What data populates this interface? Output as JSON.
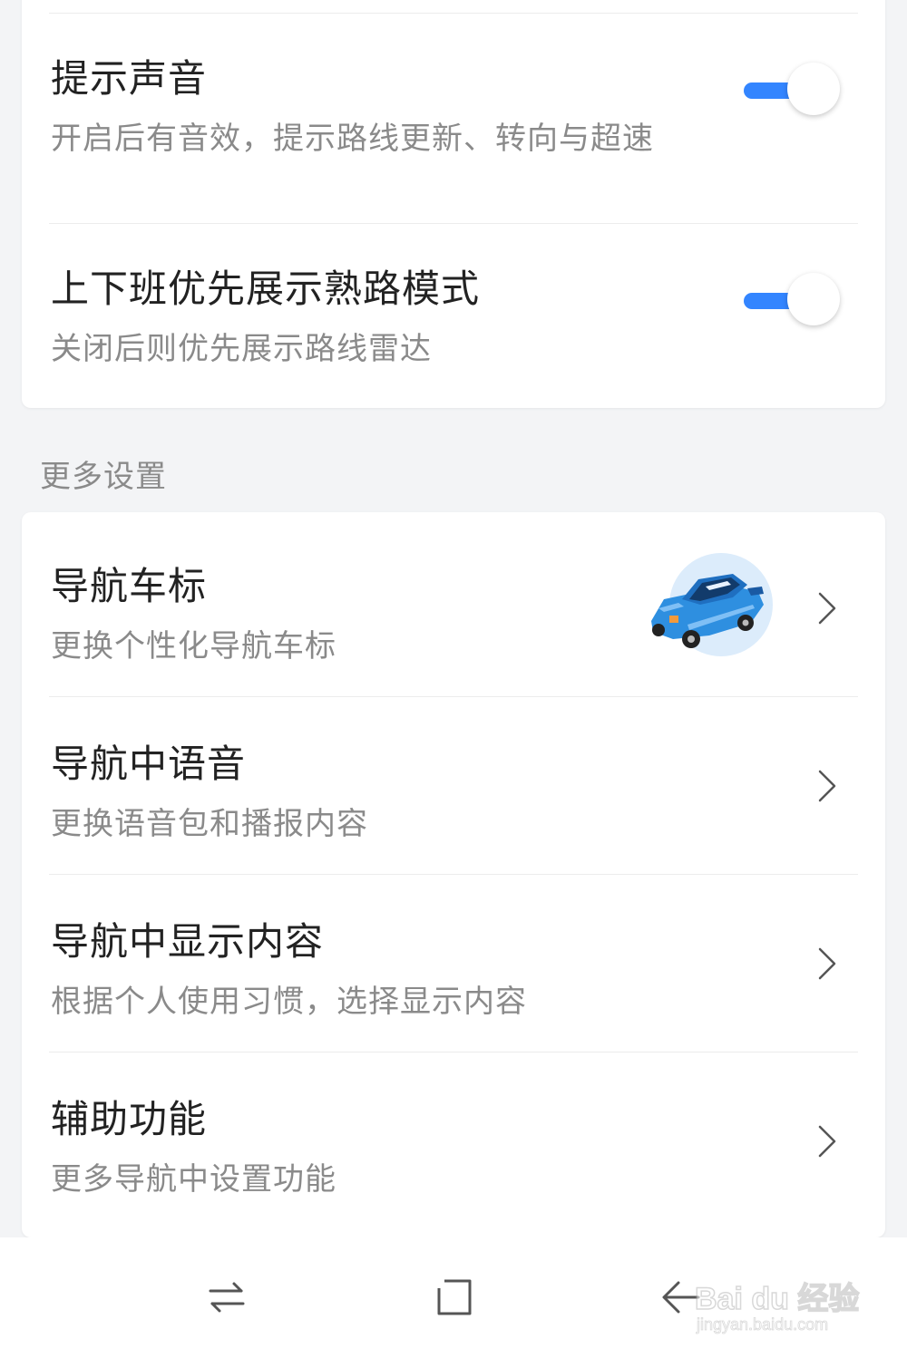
{
  "colors": {
    "accent": "#3385ff",
    "background": "#f3f4f6",
    "title_text": "#222222",
    "subtitle_text": "#8a8a8a"
  },
  "top_settings": [
    {
      "title": "提示声音",
      "subtitle": "开启后有音效，提示路线更新、转向与超速",
      "toggle_on": true
    },
    {
      "title": "上下班优先展示熟路模式",
      "subtitle": "关闭后则优先展示路线雷达",
      "toggle_on": true
    }
  ],
  "more_settings": {
    "section_label": "更多设置",
    "items": [
      {
        "title": "导航车标",
        "subtitle": "更换个性化导航车标",
        "icon": "blue-car-icon"
      },
      {
        "title": "导航中语音",
        "subtitle": "更换语音包和播报内容"
      },
      {
        "title": "导航中显示内容",
        "subtitle": "根据个人使用习惯，选择显示内容"
      },
      {
        "title": "辅助功能",
        "subtitle": "更多导航中设置功能"
      }
    ]
  },
  "system_nav": {
    "buttons": [
      "recent-apps-icon",
      "home-icon",
      "back-icon"
    ]
  },
  "watermark": {
    "main": "Bai du 经验",
    "sub": "jingyan.baidu.com"
  }
}
